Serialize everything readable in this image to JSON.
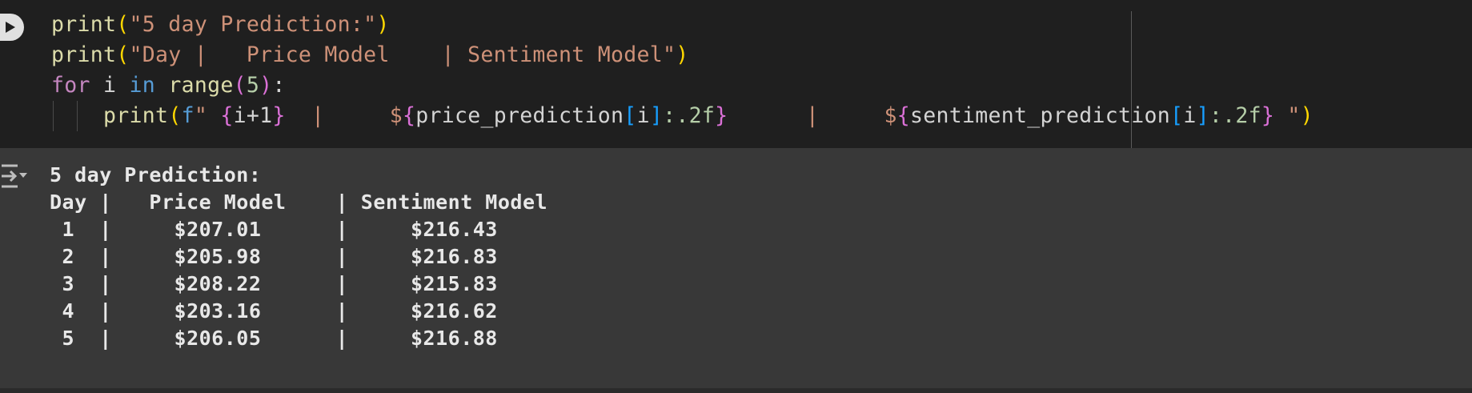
{
  "code_cell": {
    "lines": [
      {
        "tokens": [
          {
            "t": "print",
            "c": "fn"
          },
          {
            "t": "(",
            "c": "paren"
          },
          {
            "t": "\"5 day Prediction:\"",
            "c": "str"
          },
          {
            "t": ")",
            "c": "paren"
          }
        ]
      },
      {
        "tokens": [
          {
            "t": "print",
            "c": "fn"
          },
          {
            "t": "(",
            "c": "paren"
          },
          {
            "t": "\"Day |   Price Model    | Sentiment Model\"",
            "c": "str"
          },
          {
            "t": ")",
            "c": "paren"
          }
        ]
      },
      {
        "tokens": [
          {
            "t": "for",
            "c": "kw"
          },
          {
            "t": " i ",
            "c": "var"
          },
          {
            "t": "in",
            "c": "kw2"
          },
          {
            "t": " ",
            "c": "var"
          },
          {
            "t": "range",
            "c": "fn"
          },
          {
            "t": "(",
            "c": "brace-p"
          },
          {
            "t": "5",
            "c": "num"
          },
          {
            "t": ")",
            "c": "brace-p"
          },
          {
            "t": ":",
            "c": "var"
          }
        ]
      },
      {
        "indent": true,
        "tokens": [
          {
            "t": "    ",
            "c": "var"
          },
          {
            "t": "print",
            "c": "fn"
          },
          {
            "t": "(",
            "c": "paren"
          },
          {
            "t": "f",
            "c": "kw2"
          },
          {
            "t": "\" ",
            "c": "str"
          },
          {
            "t": "{",
            "c": "brace-p"
          },
          {
            "t": "i+1",
            "c": "var"
          },
          {
            "t": "}",
            "c": "brace-p"
          },
          {
            "t": "  |     $",
            "c": "str"
          },
          {
            "t": "{",
            "c": "brace-p"
          },
          {
            "t": "price_prediction",
            "c": "var"
          },
          {
            "t": "[",
            "c": "brack"
          },
          {
            "t": "i",
            "c": "var"
          },
          {
            "t": "]",
            "c": "brack"
          },
          {
            "t": ":.2f",
            "c": "num"
          },
          {
            "t": "}",
            "c": "brace-p"
          },
          {
            "t": "      |     $",
            "c": "str"
          },
          {
            "t": "{",
            "c": "brace-p"
          },
          {
            "t": "sentiment_prediction",
            "c": "var"
          },
          {
            "t": "[",
            "c": "brack"
          },
          {
            "t": "i",
            "c": "var"
          },
          {
            "t": "]",
            "c": "brack"
          },
          {
            "t": ":.2f",
            "c": "num"
          },
          {
            "t": "}",
            "c": "brace-p"
          },
          {
            "t": " \"",
            "c": "str"
          },
          {
            "t": ")",
            "c": "paren"
          }
        ]
      }
    ]
  },
  "output": {
    "lines": [
      "5 day Prediction:",
      "Day |   Price Model    | Sentiment Model",
      " 1  |     $207.01      |     $216.43",
      " 2  |     $205.98      |     $216.83",
      " 3  |     $208.22      |     $215.83",
      " 4  |     $203.16      |     $216.62",
      " 5  |     $206.05      |     $216.88"
    ]
  },
  "icons": {
    "run": "play-icon",
    "output": "output-collapse-icon"
  }
}
